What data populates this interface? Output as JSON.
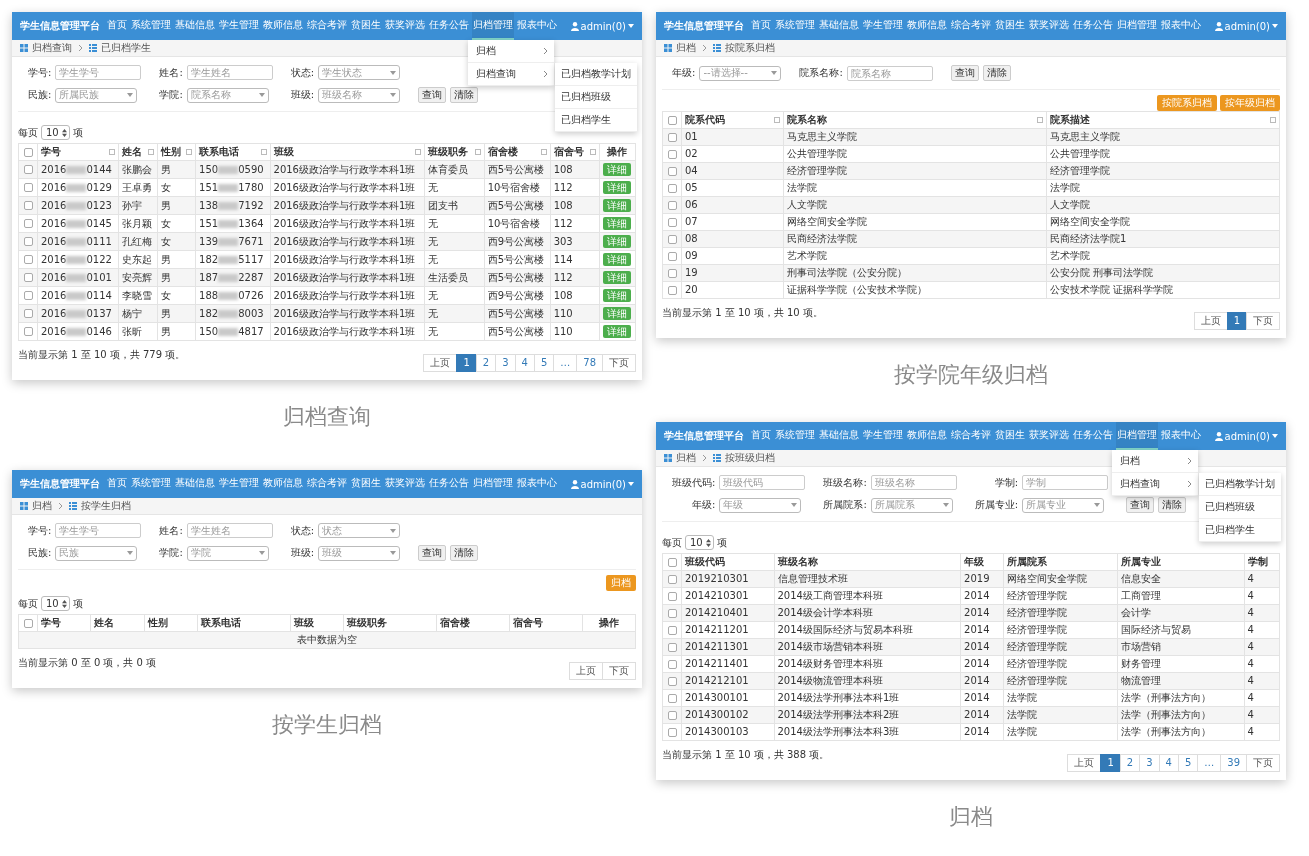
{
  "panels": [
    {
      "caption": "归档查询",
      "nav": {
        "brand": "学生信息管理平台",
        "user": "admin(0)",
        "items": [
          {
            "label": "首页",
            "selected": false
          },
          {
            "label": "系统管理",
            "selected": false
          },
          {
            "label": "基础信息",
            "selected": false
          },
          {
            "label": "学生管理",
            "selected": false
          },
          {
            "label": "教师信息",
            "selected": false
          },
          {
            "label": "综合考评",
            "selected": false
          },
          {
            "label": "贫困生",
            "selected": false
          },
          {
            "label": "获奖评选",
            "selected": false
          },
          {
            "label": "任务公告",
            "selected": false
          },
          {
            "label": "归档管理",
            "selected": true
          },
          {
            "label": "报表中心",
            "selected": false
          }
        ]
      },
      "menu": {
        "items": [
          {
            "label": "归档",
            "expanded": false
          },
          {
            "label": "归档查询",
            "expanded": true
          }
        ],
        "submenu": [
          "已归档教学计划",
          "已归档班级",
          "已归档学生"
        ]
      },
      "breadcrumb": [
        "归档查询",
        "已归档学生"
      ],
      "filters": {
        "rows": [
          [
            {
              "label": "学号:",
              "kind": "input",
              "placeholder": "学生学号"
            },
            {
              "label": "姓名:",
              "kind": "input",
              "placeholder": "学生姓名"
            },
            {
              "label": "状态:",
              "kind": "select",
              "placeholder": "学生状态"
            }
          ],
          [
            {
              "label": "民族:",
              "kind": "select",
              "placeholder": "所属民族"
            },
            {
              "label": "学院:",
              "kind": "select",
              "placeholder": "院系名称"
            },
            {
              "label": "班级:",
              "kind": "select",
              "placeholder": "班级名称"
            }
          ]
        ],
        "buttons": [
          "查询",
          "清除"
        ]
      },
      "page_size": {
        "before": "每页",
        "value": "10",
        "after": "项"
      },
      "table": {
        "header_checked": false,
        "columns": [
          {
            "label": "学号",
            "sortable": true
          },
          {
            "label": "姓名",
            "sortable": true
          },
          {
            "label": "性别",
            "sortable": true
          },
          {
            "label": "联系电话",
            "sortable": true
          },
          {
            "label": "班级",
            "sortable": true
          },
          {
            "label": "班级职务",
            "sortable": true
          },
          {
            "label": "宿舍楼",
            "sortable": true
          },
          {
            "label": "宿舍号",
            "sortable": true
          },
          {
            "label": "操作"
          }
        ],
        "rows": [
          {
            "checked": false,
            "cells": [
              {
                "kind": "masked",
                "start": "2016",
                "end": "0144"
              },
              "张鹏会",
              "男",
              {
                "kind": "masked",
                "start": "150",
                "end": "0590"
              },
              "2016级政治学与行政学本科1班",
              "体育委员",
              "西5号公寓楼",
              "108",
              {
                "kind": "button",
                "label": "详细"
              }
            ]
          },
          {
            "checked": false,
            "cells": [
              {
                "kind": "masked",
                "start": "2016",
                "end": "0129"
              },
              "王卓勇",
              "女",
              {
                "kind": "masked",
                "start": "151",
                "end": "1780"
              },
              "2016级政治学与行政学本科1班",
              "无",
              "10号宿舍楼",
              "112",
              {
                "kind": "button",
                "label": "详细"
              }
            ]
          },
          {
            "checked": false,
            "cells": [
              {
                "kind": "masked",
                "start": "2016",
                "end": "0123"
              },
              "孙宇",
              "男",
              {
                "kind": "masked",
                "start": "138",
                "end": "7192"
              },
              "2016级政治学与行政学本科1班",
              "团支书",
              "西5号公寓楼",
              "108",
              {
                "kind": "button",
                "label": "详细"
              }
            ]
          },
          {
            "checked": false,
            "cells": [
              {
                "kind": "masked",
                "start": "2016",
                "end": "0145"
              },
              "张月颖",
              "女",
              {
                "kind": "masked",
                "start": "151",
                "end": "1364"
              },
              "2016级政治学与行政学本科1班",
              "无",
              "10号宿舍楼",
              "112",
              {
                "kind": "button",
                "label": "详细"
              }
            ]
          },
          {
            "checked": false,
            "cells": [
              {
                "kind": "masked",
                "start": "2016",
                "end": "0111"
              },
              "孔红梅",
              "女",
              {
                "kind": "masked",
                "start": "139",
                "end": "7671"
              },
              "2016级政治学与行政学本科1班",
              "无",
              "西9号公寓楼",
              "303",
              {
                "kind": "button",
                "label": "详细"
              }
            ]
          },
          {
            "checked": false,
            "cells": [
              {
                "kind": "masked",
                "start": "2016",
                "end": "0122"
              },
              "史东起",
              "男",
              {
                "kind": "masked",
                "start": "182",
                "end": "5117"
              },
              "2016级政治学与行政学本科1班",
              "无",
              "西5号公寓楼",
              "114",
              {
                "kind": "button",
                "label": "详细"
              }
            ]
          },
          {
            "checked": false,
            "cells": [
              {
                "kind": "masked",
                "start": "2016",
                "end": "0101"
              },
              "安亮辉",
              "男",
              {
                "kind": "masked",
                "start": "187",
                "end": "2287"
              },
              "2016级政治学与行政学本科1班",
              "生活委员",
              "西5号公寓楼",
              "112",
              {
                "kind": "button",
                "label": "详细"
              }
            ]
          },
          {
            "checked": false,
            "cells": [
              {
                "kind": "masked",
                "start": "2016",
                "end": "0114"
              },
              "李晓雪",
              "女",
              {
                "kind": "masked",
                "start": "188",
                "end": "0726"
              },
              "2016级政治学与行政学本科1班",
              "无",
              "西9号公寓楼",
              "108",
              {
                "kind": "button",
                "label": "详细"
              }
            ]
          },
          {
            "checked": false,
            "cells": [
              {
                "kind": "masked",
                "start": "2016",
                "end": "0137"
              },
              "杨宁",
              "男",
              {
                "kind": "masked",
                "start": "182",
                "end": "8003"
              },
              "2016级政治学与行政学本科1班",
              "无",
              "西5号公寓楼",
              "110",
              {
                "kind": "button",
                "label": "详细"
              }
            ]
          },
          {
            "checked": false,
            "cells": [
              {
                "kind": "masked",
                "start": "2016",
                "end": "0146"
              },
              "张昕",
              "男",
              {
                "kind": "masked",
                "start": "150",
                "end": "4817"
              },
              "2016级政治学与行政学本科1班",
              "无",
              "西5号公寓楼",
              "110",
              {
                "kind": "button",
                "label": "详细"
              }
            ]
          }
        ]
      },
      "info": "当前显示第 1 至 10 项，共 779 项。",
      "pagination": [
        {
          "label": "上页",
          "selected": false
        },
        {
          "label": "1",
          "selected": true
        },
        {
          "label": "2",
          "selected": false
        },
        {
          "label": "3",
          "selected": false
        },
        {
          "label": "4",
          "selected": false
        },
        {
          "label": "5",
          "selected": false
        },
        {
          "label": "…",
          "selected": false
        },
        {
          "label": "78",
          "selected": false
        },
        {
          "label": "下页",
          "selected": false
        }
      ]
    },
    {
      "caption": "按学生归档",
      "nav": {
        "brand": "学生信息管理平台",
        "user": "admin(0)",
        "items": [
          {
            "label": "首页",
            "selected": false
          },
          {
            "label": "系统管理",
            "selected": false
          },
          {
            "label": "基础信息",
            "selected": false
          },
          {
            "label": "学生管理",
            "selected": false
          },
          {
            "label": "教师信息",
            "selected": false
          },
          {
            "label": "综合考评",
            "selected": false
          },
          {
            "label": "贫困生",
            "selected": false
          },
          {
            "label": "获奖评选",
            "selected": false
          },
          {
            "label": "任务公告",
            "selected": false
          },
          {
            "label": "归档管理",
            "selected": false
          },
          {
            "label": "报表中心",
            "selected": false
          }
        ]
      },
      "breadcrumb": [
        "归档",
        "按学生归档"
      ],
      "filters": {
        "rows": [
          [
            {
              "label": "学号:",
              "kind": "input",
              "placeholder": "学生学号"
            },
            {
              "label": "姓名:",
              "kind": "input",
              "placeholder": "学生姓名"
            },
            {
              "label": "状态:",
              "kind": "select",
              "placeholder": "状态"
            }
          ],
          [
            {
              "label": "民族:",
              "kind": "select",
              "placeholder": "民族"
            },
            {
              "label": "学院:",
              "kind": "select",
              "placeholder": "学院"
            },
            {
              "label": "班级:",
              "kind": "select",
              "placeholder": "班级"
            }
          ]
        ],
        "buttons": [
          "查询",
          "清除"
        ]
      },
      "actions": [
        "归档"
      ],
      "page_size": {
        "before": "每页",
        "value": "10",
        "after": "项"
      },
      "table": {
        "header_checked": false,
        "columns": [
          {
            "label": "学号"
          },
          {
            "label": "姓名"
          },
          {
            "label": "性别"
          },
          {
            "label": "联系电话"
          },
          {
            "label": "班级"
          },
          {
            "label": "班级职务"
          },
          {
            "label": "宿舍楼"
          },
          {
            "label": "宿舍号"
          },
          {
            "label": "操作"
          }
        ],
        "empty_text": "表中数据为空"
      },
      "info": "当前显示第 0 至 0 项，共 0 项",
      "pagination": [
        {
          "label": "上页",
          "selected": false
        },
        {
          "label": "下页",
          "selected": false
        }
      ]
    },
    {
      "caption": "按学院年级归档",
      "nav": {
        "brand": "学生信息管理平台",
        "user": "admin(0)",
        "items": [
          {
            "label": "首页",
            "selected": false
          },
          {
            "label": "系统管理",
            "selected": false
          },
          {
            "label": "基础信息",
            "selected": false
          },
          {
            "label": "学生管理",
            "selected": false
          },
          {
            "label": "教师信息",
            "selected": false
          },
          {
            "label": "综合考评",
            "selected": false
          },
          {
            "label": "贫困生",
            "selected": false
          },
          {
            "label": "获奖评选",
            "selected": false
          },
          {
            "label": "任务公告",
            "selected": false
          },
          {
            "label": "归档管理",
            "selected": false
          },
          {
            "label": "报表中心",
            "selected": false
          }
        ]
      },
      "breadcrumb": [
        "归档",
        "按院系归档"
      ],
      "filters": {
        "rows": [
          [
            {
              "label": "年级:",
              "kind": "select",
              "placeholder": "--请选择--"
            },
            {
              "label": "院系名称:",
              "kind": "input",
              "placeholder": "院系名称"
            }
          ]
        ],
        "buttons": [
          "查询",
          "清除"
        ]
      },
      "actions": [
        "按院系归档",
        "按年级归档"
      ],
      "table": {
        "header_checked": false,
        "columns": [
          {
            "label": "院系代码",
            "sortable": true
          },
          {
            "label": "院系名称",
            "sortable": true
          },
          {
            "label": "院系描述",
            "sortable": true
          }
        ],
        "rows": [
          {
            "checked": false,
            "cells": [
              "01",
              "马克思主义学院",
              "马克思主义学院"
            ]
          },
          {
            "checked": false,
            "cells": [
              "02",
              "公共管理学院",
              "公共管理学院"
            ]
          },
          {
            "checked": false,
            "cells": [
              "04",
              "经济管理学院",
              "经济管理学院"
            ]
          },
          {
            "checked": false,
            "cells": [
              "05",
              "法学院",
              "法学院"
            ]
          },
          {
            "checked": false,
            "cells": [
              "06",
              "人文学院",
              "人文学院"
            ]
          },
          {
            "checked": false,
            "cells": [
              "07",
              "网络空间安全学院",
              "网络空间安全学院"
            ]
          },
          {
            "checked": false,
            "cells": [
              "08",
              "民商经济法学院",
              "民商经济法学院1"
            ]
          },
          {
            "checked": false,
            "cells": [
              "09",
              "艺术学院",
              "艺术学院"
            ]
          },
          {
            "checked": false,
            "cells": [
              "19",
              "刑事司法学院（公安分院）",
              "公安分院 刑事司法学院"
            ]
          },
          {
            "checked": false,
            "cells": [
              "20",
              "证据科学学院（公安技术学院）",
              "公安技术学院 证据科学学院"
            ]
          }
        ]
      },
      "info": "当前显示第 1 至 10 项，共 10 项。",
      "pagination": [
        {
          "label": "上页",
          "selected": false
        },
        {
          "label": "1",
          "selected": true
        },
        {
          "label": "下页",
          "selected": false
        }
      ]
    },
    {
      "caption": "归档",
      "nav": {
        "brand": "学生信息管理平台",
        "user": "admin(0)",
        "items": [
          {
            "label": "首页",
            "selected": false
          },
          {
            "label": "系统管理",
            "selected": false
          },
          {
            "label": "基础信息",
            "selected": false
          },
          {
            "label": "学生管理",
            "selected": false
          },
          {
            "label": "教师信息",
            "selected": false
          },
          {
            "label": "综合考评",
            "selected": false
          },
          {
            "label": "贫困生",
            "selected": false
          },
          {
            "label": "获奖评选",
            "selected": false
          },
          {
            "label": "任务公告",
            "selected": false
          },
          {
            "label": "归档管理",
            "selected": true
          },
          {
            "label": "报表中心",
            "selected": false
          }
        ]
      },
      "menu": {
        "items": [
          {
            "label": "归档",
            "expanded": false
          },
          {
            "label": "归档查询",
            "expanded": true
          }
        ],
        "submenu": [
          "已归档教学计划",
          "已归档班级",
          "已归档学生"
        ]
      },
      "breadcrumb": [
        "归档",
        "按班级归档"
      ],
      "filters": {
        "rows": [
          [
            {
              "label": "班级代码:",
              "kind": "input",
              "placeholder": "班级代码"
            },
            {
              "label": "班级名称:",
              "kind": "input",
              "placeholder": "班级名称"
            },
            {
              "label": "学制:",
              "kind": "input",
              "placeholder": "学制"
            }
          ],
          [
            {
              "label": "年级:",
              "kind": "select",
              "placeholder": "年级"
            },
            {
              "label": "所属院系:",
              "kind": "select",
              "placeholder": "所属院系"
            },
            {
              "label": "所属专业:",
              "kind": "select",
              "placeholder": "所属专业"
            }
          ]
        ],
        "buttons": [
          "查询",
          "清除"
        ]
      },
      "page_size": {
        "before": "每页",
        "value": "10",
        "after": "项"
      },
      "table": {
        "header_checked": false,
        "columns": [
          {
            "label": "班级代码"
          },
          {
            "label": "班级名称"
          },
          {
            "label": "年级"
          },
          {
            "label": "所属院系"
          },
          {
            "label": "所属专业"
          },
          {
            "label": "学制"
          }
        ],
        "rows": [
          {
            "checked": false,
            "cells": [
              "2019210301",
              "信息管理技术班",
              "2019",
              "网络空间安全学院",
              "信息安全",
              "4"
            ]
          },
          {
            "checked": false,
            "cells": [
              "2014210301",
              "2014级工商管理本科班",
              "2014",
              "经济管理学院",
              "工商管理",
              "4"
            ]
          },
          {
            "checked": false,
            "cells": [
              "2014210401",
              "2014级会计学本科班",
              "2014",
              "经济管理学院",
              "会计学",
              "4"
            ]
          },
          {
            "checked": false,
            "cells": [
              "2014211201",
              "2014级国际经济与贸易本科班",
              "2014",
              "经济管理学院",
              "国际经济与贸易",
              "4"
            ]
          },
          {
            "checked": false,
            "cells": [
              "2014211301",
              "2014级市场营销本科班",
              "2014",
              "经济管理学院",
              "市场营销",
              "4"
            ]
          },
          {
            "checked": false,
            "cells": [
              "2014211401",
              "2014级财务管理本科班",
              "2014",
              "经济管理学院",
              "财务管理",
              "4"
            ]
          },
          {
            "checked": false,
            "cells": [
              "2014212101",
              "2014级物流管理本科班",
              "2014",
              "经济管理学院",
              "物流管理",
              "4"
            ]
          },
          {
            "checked": false,
            "cells": [
              "2014300101",
              "2014级法学刑事法本科1班",
              "2014",
              "法学院",
              "法学（刑事法方向）",
              "4"
            ]
          },
          {
            "checked": false,
            "cells": [
              "2014300102",
              "2014级法学刑事法本科2班",
              "2014",
              "法学院",
              "法学（刑事法方向）",
              "4"
            ]
          },
          {
            "checked": false,
            "cells": [
              "2014300103",
              "2014级法学刑事法本科3班",
              "2014",
              "法学院",
              "法学（刑事法方向）",
              "4"
            ]
          }
        ]
      },
      "info": "当前显示第 1 至 10 项，共 388 项。",
      "pagination": [
        {
          "label": "上页",
          "selected": false
        },
        {
          "label": "1",
          "selected": true
        },
        {
          "label": "2",
          "selected": false
        },
        {
          "label": "3",
          "selected": false
        },
        {
          "label": "4",
          "selected": false
        },
        {
          "label": "5",
          "selected": false
        },
        {
          "label": "…",
          "selected": false
        },
        {
          "label": "39",
          "selected": false
        },
        {
          "label": "下页",
          "selected": false
        }
      ]
    }
  ]
}
